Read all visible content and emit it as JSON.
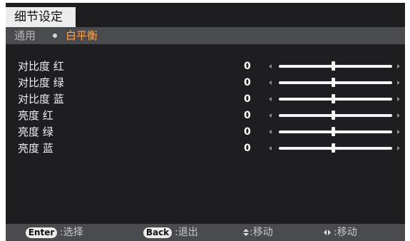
{
  "menu": {
    "title": "细节设定",
    "breadcrumb": {
      "parent": "通用",
      "current": "白平衡"
    }
  },
  "settings": [
    {
      "label": "对比度 红",
      "value": "0",
      "level_percent": 48
    },
    {
      "label": "对比度 绿",
      "value": "0",
      "level_percent": 48
    },
    {
      "label": "对比度 蓝",
      "value": "0",
      "level_percent": 48
    },
    {
      "label": "亮度 红",
      "value": "0",
      "level_percent": 48
    },
    {
      "label": "亮度 绿",
      "value": "0",
      "level_percent": 48
    },
    {
      "label": "亮度 蓝",
      "value": "0",
      "level_percent": 48
    }
  ],
  "footer": {
    "enter_key": "Enter",
    "enter_text": ":选择",
    "back_key": "Back",
    "back_text": ":退出",
    "updown_text": ":移动",
    "leftright_text": ":移动"
  },
  "colors": {
    "accent": "#ffa64a",
    "background": "#1e1e21",
    "bar": "#4a4b4f"
  }
}
